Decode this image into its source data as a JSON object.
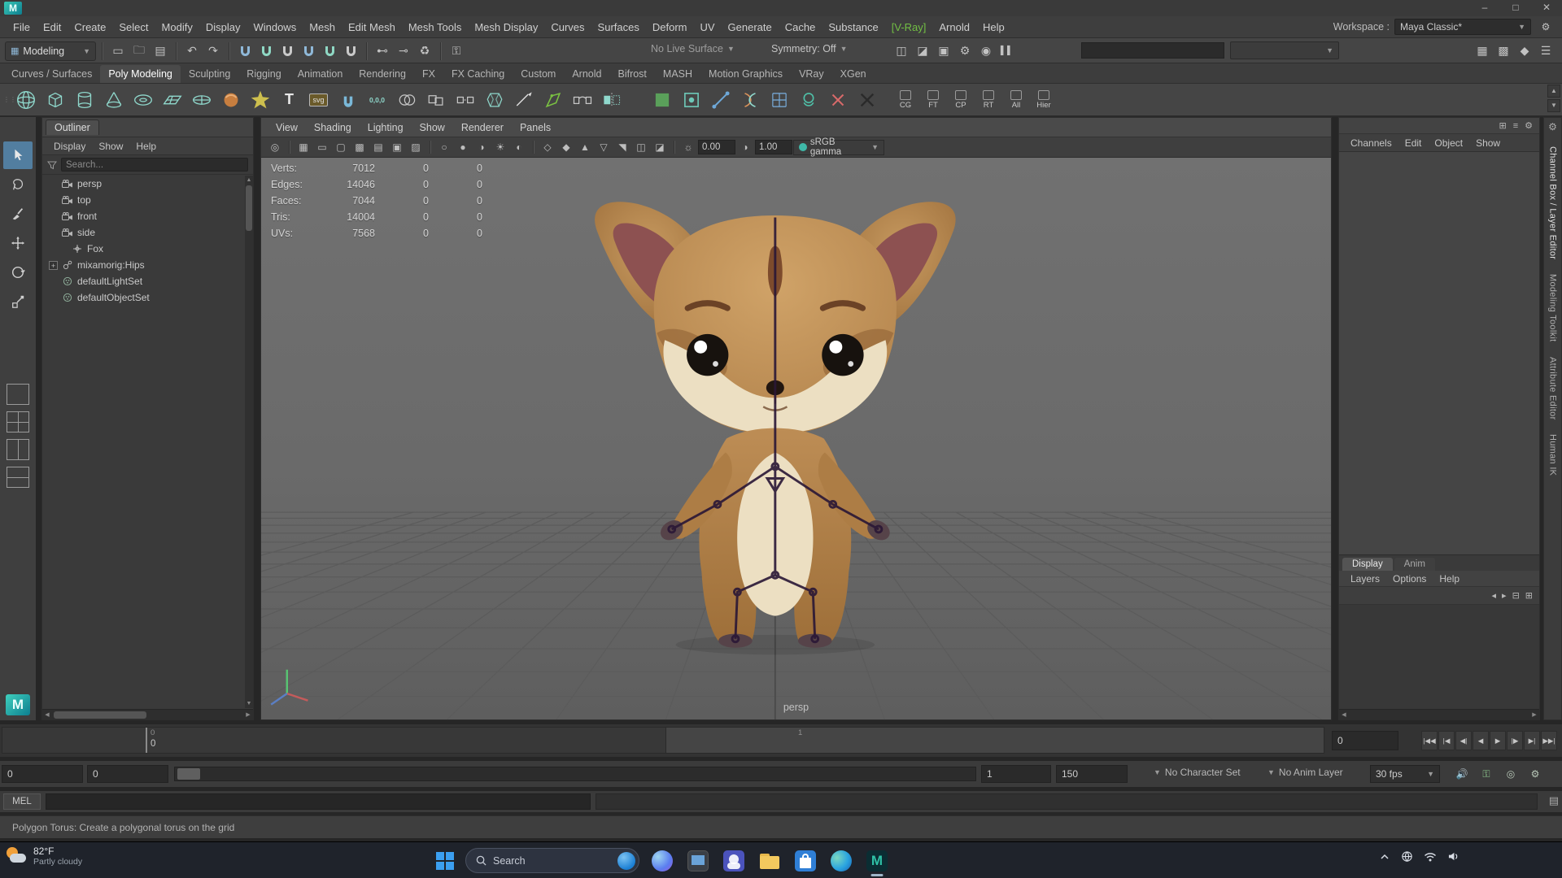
{
  "palette": {
    "vray-green": "#72bf44",
    "accent-blue": "#527ea0",
    "shelf-teal": "#8fd8cc",
    "fox-cream": "#ecdfc2",
    "fox-ear-inner": "#8d5151",
    "fox-paw": "#564349",
    "skeleton-purple": "#2a1736",
    "taskbar-bg": "#1f232b",
    "viewport-bg": "#6a6a6a"
  },
  "menubar": {
    "items": [
      "File",
      "Edit",
      "Create",
      "Select",
      "Modify",
      "Display",
      "Windows",
      "Mesh",
      "Edit Mesh",
      "Mesh Tools",
      "Mesh Display",
      "Curves",
      "Surfaces",
      "Deform",
      "UV",
      "Generate",
      "Cache",
      "Substance",
      "[V-Ray]",
      "Arnold",
      "Help"
    ]
  },
  "workspace": {
    "label": "Workspace :",
    "value": "Maya Classic*"
  },
  "toolbar": {
    "mode": "Modeling",
    "no_live_surface": "No Live Surface",
    "symmetry": "Symmetry: Off"
  },
  "shelf": {
    "tabs": [
      "Curves / Surfaces",
      "Poly Modeling",
      "Sculpting",
      "Rigging",
      "Animation",
      "Rendering",
      "FX",
      "FX Caching",
      "Custom",
      "Arnold",
      "Bifrost",
      "MASH",
      "Motion Graphics",
      "VRay",
      "XGen"
    ],
    "active_tab": "Poly Modeling",
    "masks": [
      "CG",
      "FT",
      "CP",
      "RT",
      "All",
      "Hier"
    ]
  },
  "toolbox": {
    "tools": [
      "select-tool",
      "lasso-tool",
      "paint-select-tool",
      "move-tool",
      "rotate-tool",
      "scale-tool"
    ]
  },
  "outliner": {
    "title": "Outliner",
    "menus": [
      "Display",
      "Show",
      "Help"
    ],
    "search_placeholder": "Search...",
    "items": [
      {
        "label": "persp",
        "icon": "camera-icon"
      },
      {
        "label": "top",
        "icon": "camera-icon"
      },
      {
        "label": "front",
        "icon": "camera-icon"
      },
      {
        "label": "side",
        "icon": "camera-icon"
      },
      {
        "label": "Fox",
        "icon": "transform-icon"
      },
      {
        "label": "mixamorig:Hips",
        "icon": "joint-icon"
      },
      {
        "label": "defaultLightSet",
        "icon": "set-icon"
      },
      {
        "label": "defaultObjectSet",
        "icon": "set-icon"
      }
    ]
  },
  "viewport": {
    "menus": [
      "View",
      "Shading",
      "Lighting",
      "Show",
      "Renderer",
      "Panels"
    ],
    "exposure": "0.00",
    "contrast": "1.00",
    "gamma": "sRGB gamma",
    "camera_label": "persp",
    "hud": {
      "rows": [
        {
          "label": "Verts:",
          "total": "7012",
          "a": "0",
          "b": "0"
        },
        {
          "label": "Edges:",
          "total": "14046",
          "a": "0",
          "b": "0"
        },
        {
          "label": "Faces:",
          "total": "7044",
          "a": "0",
          "b": "0"
        },
        {
          "label": "Tris:",
          "total": "14004",
          "a": "0",
          "b": "0"
        },
        {
          "label": "UVs:",
          "total": "7568",
          "a": "0",
          "b": "0"
        }
      ]
    }
  },
  "channel_box": {
    "menus": [
      "Channels",
      "Edit",
      "Object",
      "Show"
    ]
  },
  "layer_editor": {
    "tabs": [
      "Display",
      "Anim"
    ],
    "active_tab": "Display",
    "menus": [
      "Layers",
      "Options",
      "Help"
    ]
  },
  "side_tabs": {
    "items": [
      "Channel Box / Layer Editor",
      "Modeling Toolkit",
      "Attribute Editor",
      "Human IK"
    ]
  },
  "timeline": {
    "tick_start": "0",
    "current_frame": "0",
    "tick_mid": "1",
    "time_field": "0"
  },
  "range_slider": {
    "anim_start": "0",
    "play_start": "0",
    "play_end": "1",
    "anim_end": "150",
    "character_set": "No Character Set",
    "anim_layer": "No Anim Layer",
    "fps": "30 fps"
  },
  "command_line": {
    "label": "MEL"
  },
  "help_line": {
    "text": "Polygon Torus: Create a polygonal torus on the grid"
  },
  "taskbar": {
    "weather_temp": "82°F",
    "weather_desc": "Partly cloudy",
    "search_label": "Search",
    "apps": [
      "start",
      "copilot",
      "desktop",
      "teams",
      "file-explorer",
      "store",
      "edge",
      "maya"
    ]
  }
}
